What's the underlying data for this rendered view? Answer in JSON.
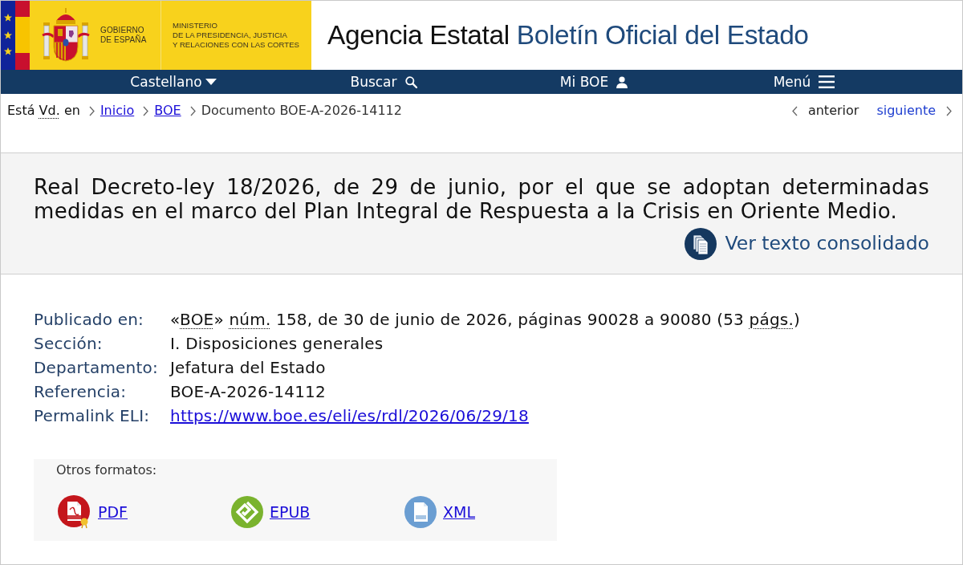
{
  "header": {
    "government": [
      "GOBIERNO",
      "DE ESPAÑA"
    ],
    "ministry": [
      "MINISTERIO",
      "DE LA PRESIDENCIA, JUSTICIA",
      "Y RELACIONES CON LAS CORTES"
    ],
    "site_title": {
      "agency": "Agencia Estatal",
      "name": "Boletín Oficial del Estado"
    }
  },
  "nav": [
    {
      "label": "Castellano",
      "kind": "language"
    },
    {
      "label": "Buscar",
      "kind": "search"
    },
    {
      "label": "Mi BOE",
      "kind": "account"
    },
    {
      "label": "Menú",
      "kind": "menu"
    }
  ],
  "breadcrumb": {
    "lead": [
      {
        "text": "Está ",
        "abbr": false
      },
      {
        "text": "Vd.",
        "abbr": true
      },
      {
        "text": " en",
        "abbr": false
      }
    ],
    "items": [
      {
        "label": "Inicio",
        "link": true
      },
      {
        "label": "BOE",
        "link": true
      },
      {
        "label": "Documento BOE-A-2026-14112",
        "link": false
      }
    ]
  },
  "pager": [
    {
      "label": "anterior",
      "kind": "previous",
      "disabled": true
    },
    {
      "label": "siguiente",
      "kind": "next",
      "disabled": false
    }
  ],
  "document": {
    "title": "Real Decreto-ley 18/2026, de 29 de junio, por el que se adoptan determinadas medidas en el marco del Plan Integral de Respuesta a la Crisis en Oriente Medio.",
    "consolidated_link": "Ver texto consolidado"
  },
  "metadata": [
    {
      "label": "Publicado en:",
      "link": false,
      "parts": [
        {
          "text": "«",
          "abbr": false
        },
        {
          "text": "BOE",
          "abbr": true
        },
        {
          "text": "» ",
          "abbr": false
        },
        {
          "text": "núm.",
          "abbr": true
        },
        {
          "text": " 158, de 30 de junio de 2026, páginas 90028 a 90080 (53 ",
          "abbr": false
        },
        {
          "text": "págs.",
          "abbr": true
        },
        {
          "text": ")",
          "abbr": false
        }
      ]
    },
    {
      "label": "Sección:",
      "link": false,
      "parts": [
        {
          "text": "I. Disposiciones generales",
          "abbr": false
        }
      ]
    },
    {
      "label": "Departamento:",
      "link": false,
      "parts": [
        {
          "text": "Jefatura del Estado",
          "abbr": false
        }
      ]
    },
    {
      "label": "Referencia:",
      "link": false,
      "parts": [
        {
          "text": "BOE-A-2026-14112",
          "abbr": false
        }
      ]
    },
    {
      "label": "Permalink ELI:",
      "link": true,
      "parts": [
        {
          "text": "https://www.boe.es/eli/es/rdl/2026/06/29/18",
          "abbr": false
        }
      ]
    }
  ],
  "formats": {
    "title": "Otros formatos:",
    "items": [
      {
        "label": "PDF",
        "kind": "pdf"
      },
      {
        "label": "EPUB",
        "kind": "epub"
      },
      {
        "label": "XML",
        "kind": "xml"
      }
    ]
  }
}
